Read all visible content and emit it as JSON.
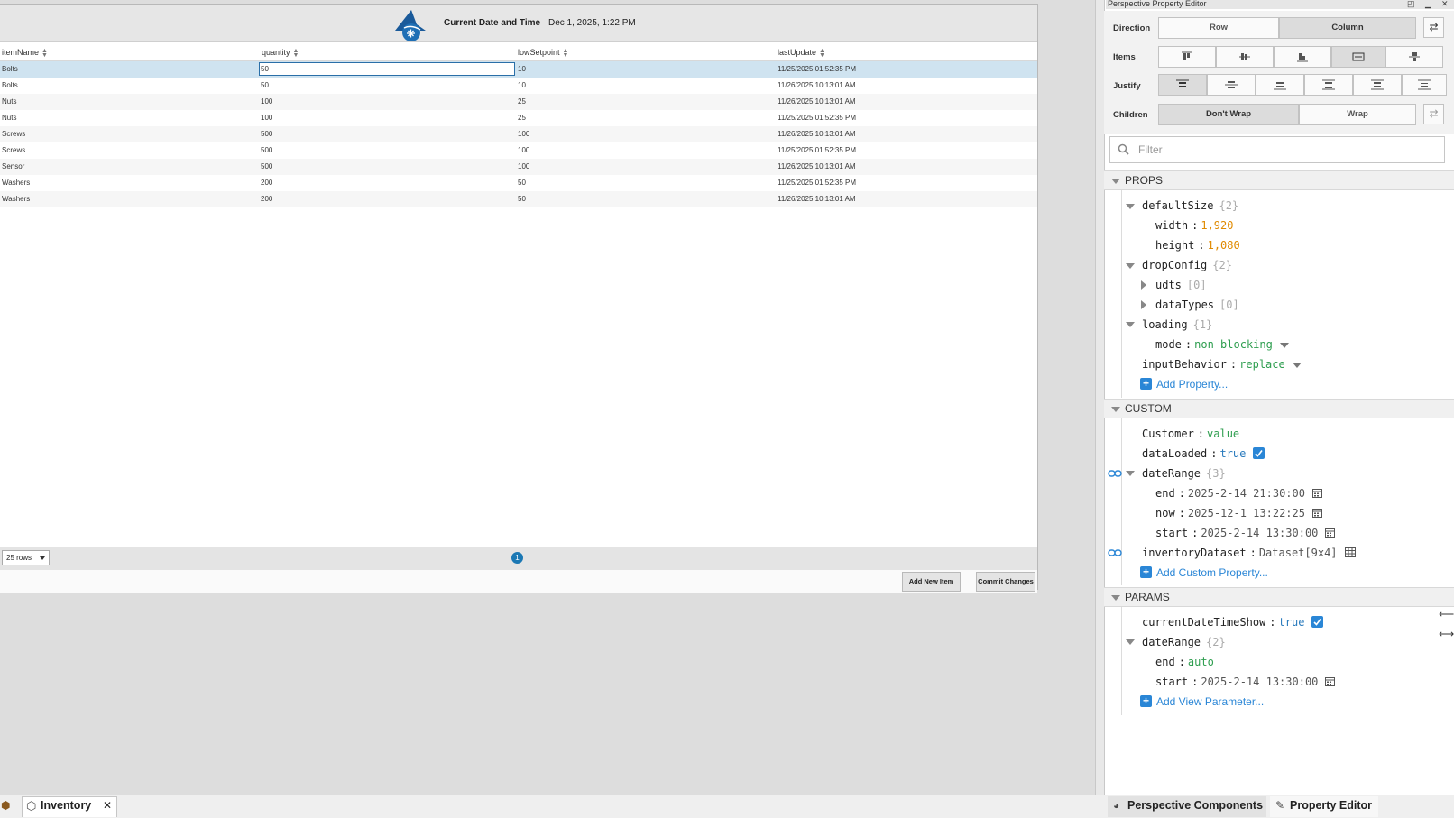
{
  "view": {
    "header": {
      "datetime_label": "Current Date and Time",
      "datetime_value": "Dec 1, 2025, 1:22 PM"
    },
    "table": {
      "columns": [
        "itemName",
        "quantity",
        "lowSetpoint",
        "lastUpdate"
      ],
      "rows": [
        [
          "Bolts",
          "50",
          "10",
          "11/25/2025 01:52:35 PM"
        ],
        [
          "Bolts",
          "50",
          "10",
          "11/26/2025 10:13:01 AM"
        ],
        [
          "Nuts",
          "100",
          "25",
          "11/26/2025 10:13:01 AM"
        ],
        [
          "Nuts",
          "100",
          "25",
          "11/25/2025 01:52:35 PM"
        ],
        [
          "Screws",
          "500",
          "100",
          "11/26/2025 10:13:01 AM"
        ],
        [
          "Screws",
          "500",
          "100",
          "11/25/2025 01:52:35 PM"
        ],
        [
          "Sensor",
          "500",
          "100",
          "11/26/2025 10:13:01 AM"
        ],
        [
          "Washers",
          "200",
          "50",
          "11/25/2025 01:52:35 PM"
        ],
        [
          "Washers",
          "200",
          "50",
          "11/26/2025 10:13:01 AM"
        ]
      ],
      "selected_row": 0
    },
    "pager": {
      "rows_select": "25 rows",
      "current_page": "1"
    },
    "actions": {
      "add_label": "Add New Item",
      "commit_label": "Commit Changes"
    }
  },
  "panel": {
    "title": "Perspective Property Editor",
    "flex": {
      "direction_label": "Direction",
      "direction_options": [
        "Row",
        "Column"
      ],
      "direction_selected": "Column",
      "items_label": "Items",
      "justify_label": "Justify",
      "children_label": "Children",
      "wrap_options": [
        "Don't Wrap",
        "Wrap"
      ],
      "wrap_selected": "Don't Wrap"
    },
    "filter_placeholder": "Filter",
    "props": {
      "section": "PROPS",
      "defaultSize": {
        "key": "defaultSize",
        "count": "{2}"
      },
      "width": {
        "key": "width",
        "value": "1,920"
      },
      "height": {
        "key": "height",
        "value": "1,080"
      },
      "dropConfig": {
        "key": "dropConfig",
        "count": "{2}"
      },
      "udts": {
        "key": "udts",
        "count": "[0]"
      },
      "dataTypes": {
        "key": "dataTypes",
        "count": "[0]"
      },
      "loading": {
        "key": "loading",
        "count": "{1}"
      },
      "mode": {
        "key": "mode",
        "value": "non-blocking"
      },
      "inputBehavior": {
        "key": "inputBehavior",
        "value": "replace"
      },
      "add": "Add Property..."
    },
    "custom": {
      "section": "CUSTOM",
      "customer": {
        "key": "Customer",
        "value": "value"
      },
      "dataLoaded": {
        "key": "dataLoaded",
        "value": "true"
      },
      "dateRange": {
        "key": "dateRange",
        "count": "{3}"
      },
      "end": {
        "key": "end",
        "value": "2025-2-14 21:30:00"
      },
      "now": {
        "key": "now",
        "value": "2025-12-1 13:22:25"
      },
      "start": {
        "key": "start",
        "value": "2025-2-14 13:30:00"
      },
      "inventoryDataset": {
        "key": "inventoryDataset",
        "value": "Dataset[9x4]"
      },
      "add": "Add Custom Property..."
    },
    "params": {
      "section": "PARAMS",
      "currentDateTimeShow": {
        "key": "currentDateTimeShow",
        "value": "true"
      },
      "dateRange": {
        "key": "dateRange",
        "count": "{2}"
      },
      "end": {
        "key": "end",
        "value": "auto"
      },
      "start": {
        "key": "start",
        "value": "2025-2-14 13:30:00"
      },
      "add": "Add View Parameter..."
    }
  },
  "bottom_tabs": {
    "inventory": "Inventory",
    "components": "Perspective Components",
    "property_editor": "Property Editor"
  },
  "colors": {
    "accent": "#2a86d6",
    "selected_row": "#cfe3f0",
    "number_value": "#e08a00",
    "string_value": "#2e9e4f",
    "bool_value": "#2a7bbd"
  }
}
